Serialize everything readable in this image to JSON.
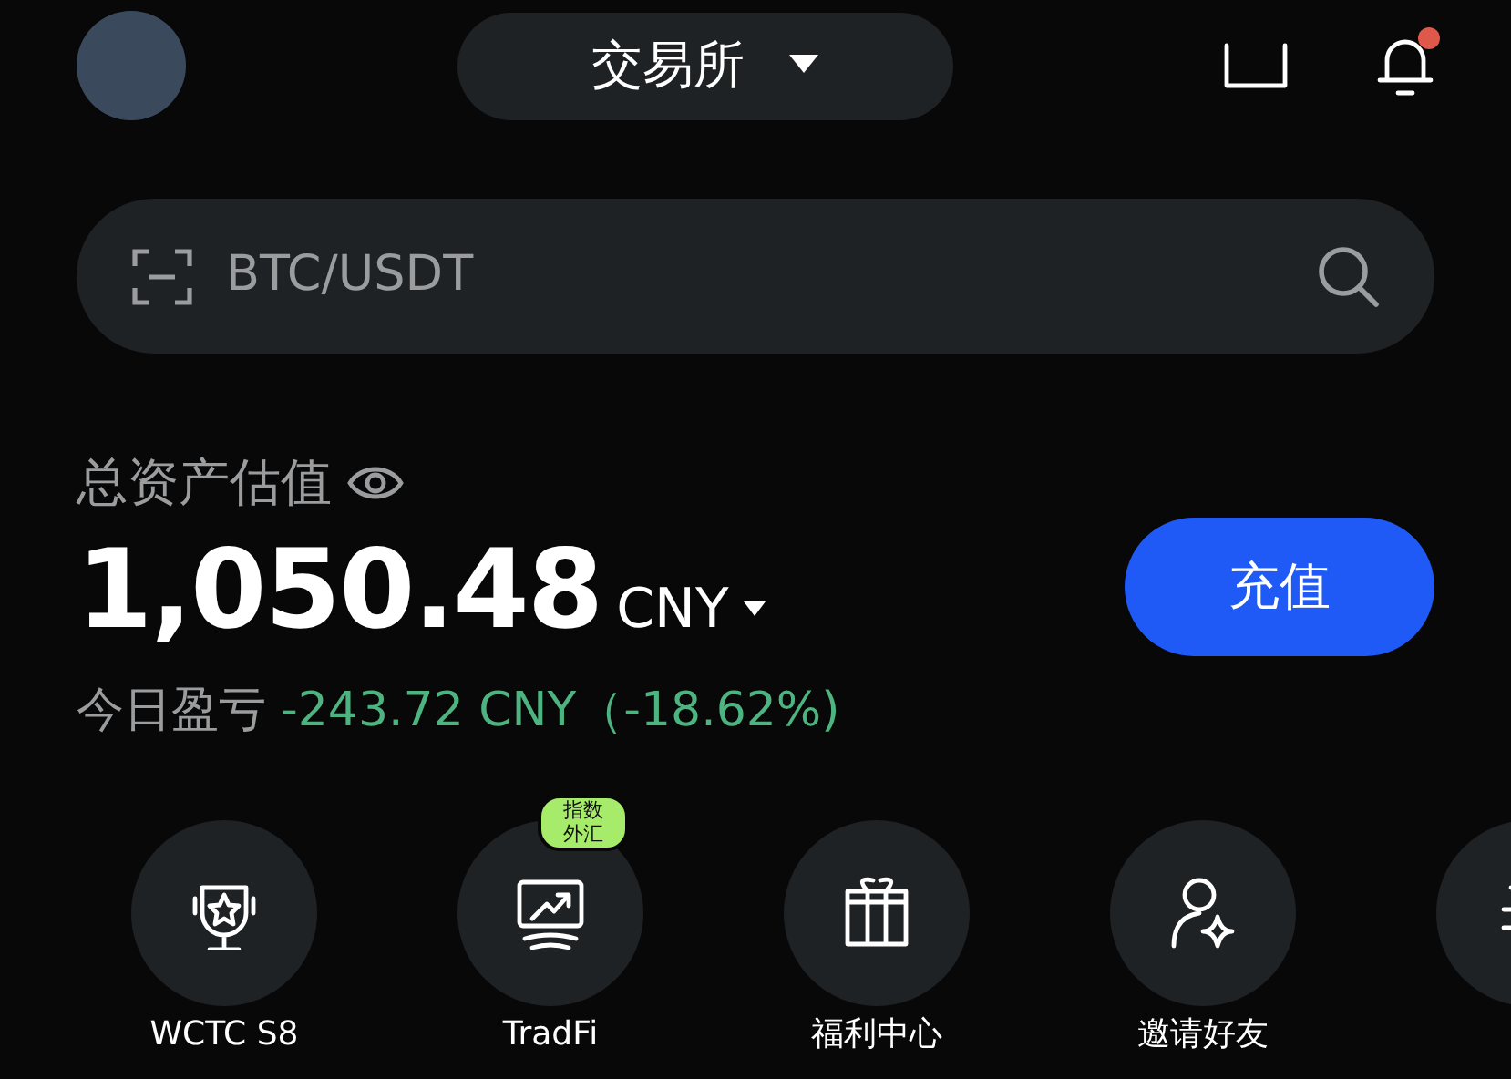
{
  "header": {
    "exchange_selector": "交易所",
    "notification_unread": true
  },
  "search": {
    "placeholder": "BTC/USDT"
  },
  "assets": {
    "label": "总资产估值",
    "amount": "1,050.48",
    "currency": "CNY",
    "pnl_label": "今日盈亏",
    "pnl_value": "-243.72 CNY（-18.62%)",
    "deposit_button": "充值"
  },
  "shortcuts": [
    {
      "kind": "trophy",
      "label": "WCTC S8"
    },
    {
      "kind": "chart",
      "label": "TradFi",
      "badge": "指数外汇"
    },
    {
      "kind": "gift",
      "label": "福利中心"
    },
    {
      "kind": "invite",
      "label": "邀请好友"
    },
    {
      "kind": "scale"
    }
  ]
}
